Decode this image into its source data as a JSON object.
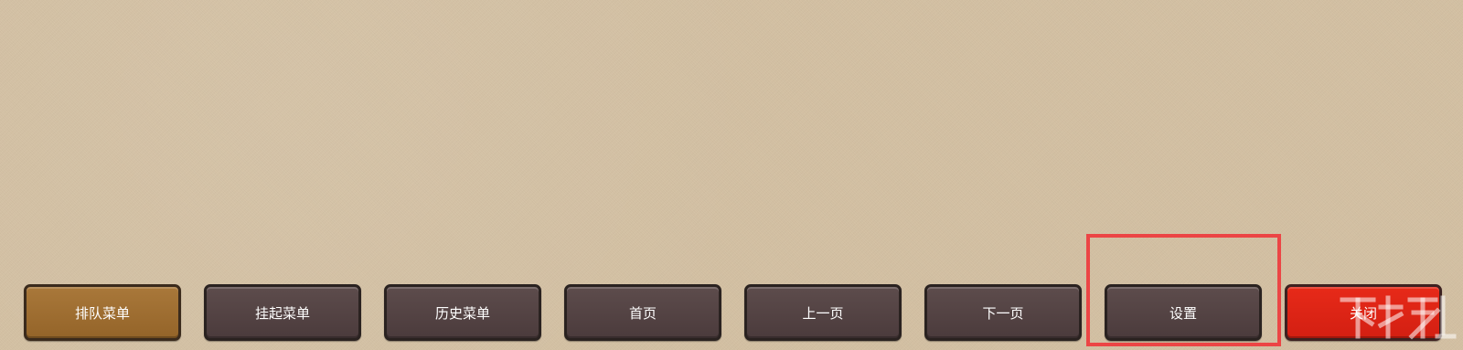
{
  "toolbar": {
    "buttons": [
      {
        "label": "排队菜单",
        "style": "gold"
      },
      {
        "label": "挂起菜单",
        "style": "dark"
      },
      {
        "label": "历史菜单",
        "style": "dark"
      },
      {
        "label": "首页",
        "style": "dark"
      },
      {
        "label": "上一页",
        "style": "dark"
      },
      {
        "label": "下一页",
        "style": "dark"
      },
      {
        "label": "设置",
        "style": "dark"
      },
      {
        "label": "关闭",
        "style": "red"
      }
    ]
  },
  "highlight": {
    "target": "设置",
    "color": "#ec4545"
  },
  "colors": {
    "background": "#d3c0a3",
    "dark_button": "#554444",
    "gold_button": "#a0702f",
    "red_button": "#e0261a"
  }
}
